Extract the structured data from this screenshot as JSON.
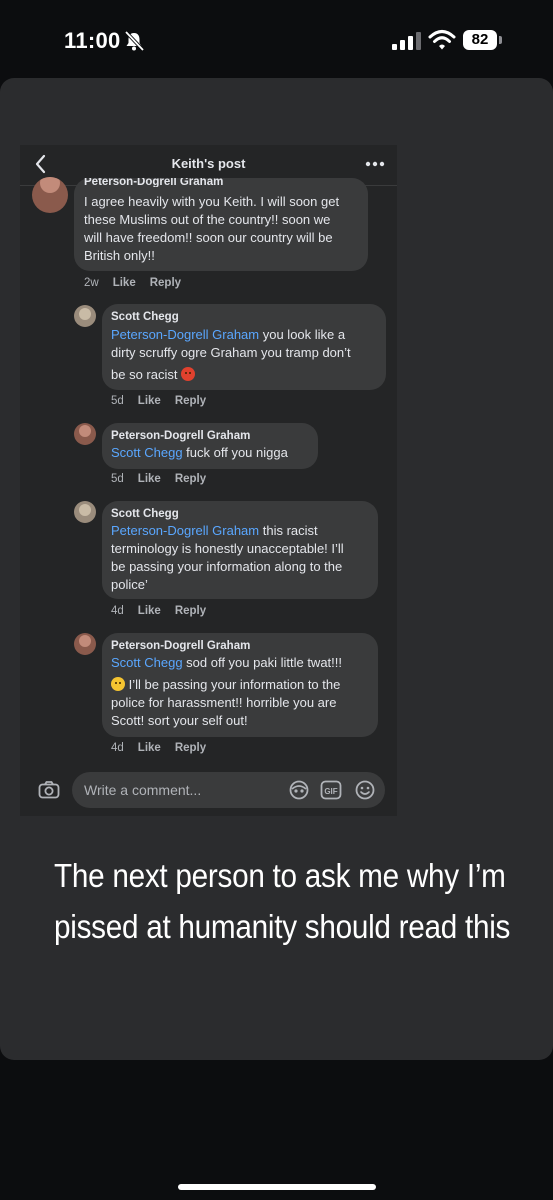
{
  "status_bar": {
    "time": "11:00",
    "battery": "82"
  },
  "post": {
    "header_title": "Keith's post",
    "comments": [
      {
        "author": "Peterson-Dogrell Graham",
        "lines": [
          "I agree heavily with you Keith. I will soon get",
          "these Muslims out of the country!! soon we",
          "will have freedom!! soon our country will be",
          "British only!!"
        ],
        "time": "2w",
        "like": "Like",
        "reply": "Reply"
      },
      {
        "author": "Scott Chegg",
        "mention": "Peterson-Dogrell Graham",
        "line1_rest": " you look like a",
        "line2": "dirty scruffy ogre Graham you tramp don’t",
        "line3": "be so racist",
        "emoji": "angry-face-emoji",
        "time": "5d",
        "like": "Like",
        "reply": "Reply"
      },
      {
        "author": "Peterson-Dogrell Graham",
        "mention": "Scott Chegg",
        "line1_rest": " fuck off you nigga",
        "time": "5d",
        "like": "Like",
        "reply": "Reply"
      },
      {
        "author": "Scott Chegg",
        "mention": "Peterson-Dogrell Graham",
        "line1_rest": " this racist",
        "line2": "terminology is honestly unacceptable! I’ll",
        "line3": "be passing your information along to the",
        "line4": "police’",
        "time": "4d",
        "like": "Like",
        "reply": "Reply"
      },
      {
        "author": "Peterson-Dogrell Graham",
        "mention": "Scott Chegg",
        "line1_rest": " sod off you paki little twat!!!",
        "line2": " I’ll be passing your information to the",
        "line3": "police for harassment!! horrible you are",
        "line4": "Scott! sort your self out!",
        "emoji": "worried-face-emoji",
        "time": "4d",
        "like": "Like",
        "reply": "Reply"
      }
    ],
    "comment_placeholder": "Write a comment..."
  },
  "caption": {
    "line1": "The next person to ask me why I’m",
    "line2": "pissed at humanity should read this"
  },
  "colors": {
    "mention": "#5aa7ff",
    "bubble": "#3a3b3c",
    "panel": "#242526",
    "card": "#2b2c2e"
  }
}
